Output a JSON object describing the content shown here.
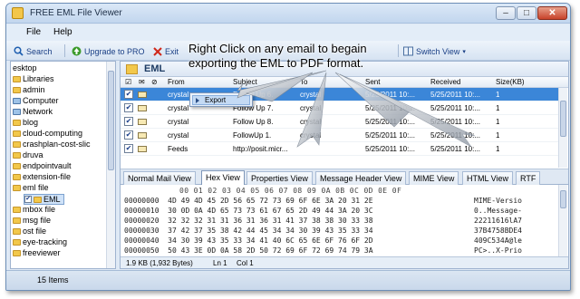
{
  "window": {
    "title": "FREE EML File Viewer"
  },
  "title_controls": {
    "minimize": "–",
    "maximize": "□",
    "close": "✕"
  },
  "menu": {
    "file": "File",
    "help": "Help"
  },
  "toolbar": {
    "search": "Search",
    "upgrade": "Upgrade to PRO",
    "exit": "Exit",
    "switch_view": "Switch View"
  },
  "annotation": {
    "line1": "Right Click on any email to begain",
    "line2": "exporting the EML to PDF format."
  },
  "tree": {
    "items": [
      {
        "label": "esktop"
      },
      {
        "label": "Libraries"
      },
      {
        "label": "admin"
      },
      {
        "label": "Computer"
      },
      {
        "label": "Network"
      },
      {
        "label": "blog"
      },
      {
        "label": "cloud-computing"
      },
      {
        "label": "crashplan-cost-slic"
      },
      {
        "label": "druva"
      },
      {
        "label": "endpointvault"
      },
      {
        "label": "extension-file"
      },
      {
        "label": "eml file"
      },
      {
        "label": "EML"
      },
      {
        "label": "mbox file"
      },
      {
        "label": "msg file"
      },
      {
        "label": "ost file"
      },
      {
        "label": "eye-tracking"
      },
      {
        "label": "freeviewer"
      }
    ]
  },
  "panel": {
    "title": "EML"
  },
  "columns": {
    "from": "From",
    "subject": "Subject",
    "to": "To",
    "sent": "Sent",
    "received": "Received",
    "size": "Size(KB)"
  },
  "emails": [
    {
      "from": "crystal",
      "subject": "Follow Up 6.",
      "to": "crystal",
      "sent": "5/25/2011 10:...",
      "received": "5/25/2011 10:...",
      "size": "1"
    },
    {
      "from": "crystal",
      "subject": "Follow Up 7.",
      "to": "crystal",
      "sent": "5/25/2011 10:...",
      "received": "5/25/2011 10:...",
      "size": "1"
    },
    {
      "from": "crystal",
      "subject": "Follow Up 8.",
      "to": "crystal",
      "sent": "5/25/2011 10:...",
      "received": "5/25/2011 10:...",
      "size": "1"
    },
    {
      "from": "crystal",
      "subject": "FollowUp 1.",
      "to": "crystal",
      "sent": "5/25/2011 10:...",
      "received": "5/25/2011 10:...",
      "size": "1"
    },
    {
      "from": "Feeds",
      "subject": "http://posit.micr...",
      "to": "",
      "sent": "5/25/2011 10:...",
      "received": "5/25/2011 10:...",
      "size": "1"
    }
  ],
  "context_menu": {
    "export": "Export"
  },
  "tabs": [
    "Normal Mail View",
    "Hex View",
    "Properties View",
    "Message Header View",
    "MIME View",
    "HTML View",
    "RTF"
  ],
  "hex": {
    "header": "00 01 02 03 04 05 06 07 08 09 0A 0B 0C 0D 0E 0F",
    "rows": [
      {
        "offset": "00000000",
        "bytes": "4D 49 4D 45 2D 56 65 72 73 69 6F 6E 3A 20 31 2E",
        "ascii": "MIME-Versio"
      },
      {
        "offset": "00000010",
        "bytes": "30 0D 0A 4D 65 73 73 61 67 65 2D 49 44 3A 20 3C",
        "ascii": "0..Message-"
      },
      {
        "offset": "00000020",
        "bytes": "32 32 32 31 31 36 31 36 31 41 37 38 38 30 33 38",
        "ascii": "22211616lA7"
      },
      {
        "offset": "00000030",
        "bytes": "37 42 37 35 38 42 44 45 34 34 30 39 43 35 33 34",
        "ascii": "37B4758BDE4"
      },
      {
        "offset": "00000040",
        "bytes": "34 30 39 43 35 33 34 41 40 6C 65 6E 6F 76 6F 2D",
        "ascii": "409C534A@le"
      },
      {
        "offset": "00000050",
        "bytes": "50 43 3E 0D 0A 58 2D 50 72 69 6F 72 69 74 79 3A",
        "ascii": "PC>..X-Prio"
      }
    ],
    "status": {
      "size": "1.9 KB (1,932 Bytes)",
      "line": "Ln 1",
      "col": "Col 1"
    }
  },
  "status": {
    "items": "15 Items"
  },
  "colors": {
    "selection": "#3b86d8",
    "tab_active": "#ffffff",
    "window_frame": "#dfe9f5"
  }
}
